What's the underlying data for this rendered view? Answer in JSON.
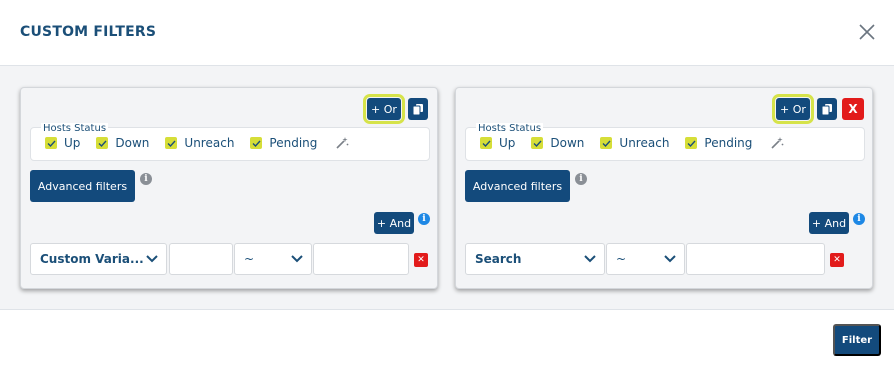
{
  "modal": {
    "title": "CUSTOM FILTERS",
    "filter_button": "Filter"
  },
  "colors": {
    "primary": "#134a7c",
    "check": "#d6de38",
    "highlight": "#d6e34a",
    "danger": "#e21b1b",
    "info": "#1e88e5"
  },
  "panels": [
    {
      "or_label": "+ Or",
      "and_label": "+ And",
      "hosts_status_label": "Hosts Status",
      "statuses": [
        "Up",
        "Down",
        "Unreach",
        "Pending"
      ],
      "advanced_label": "Advanced filters",
      "row": {
        "field_select": "Custom Varia...",
        "value_input": "",
        "operator_select": "~",
        "value2_input": ""
      }
    },
    {
      "or_label": "+ Or",
      "and_label": "+ And",
      "hosts_status_label": "Hosts Status",
      "statuses": [
        "Up",
        "Down",
        "Unreach",
        "Pending"
      ],
      "advanced_label": "Advanced filters",
      "delete_label": "X",
      "row": {
        "field_select": "Search",
        "operator_select": "~",
        "value_input": ""
      }
    }
  ]
}
